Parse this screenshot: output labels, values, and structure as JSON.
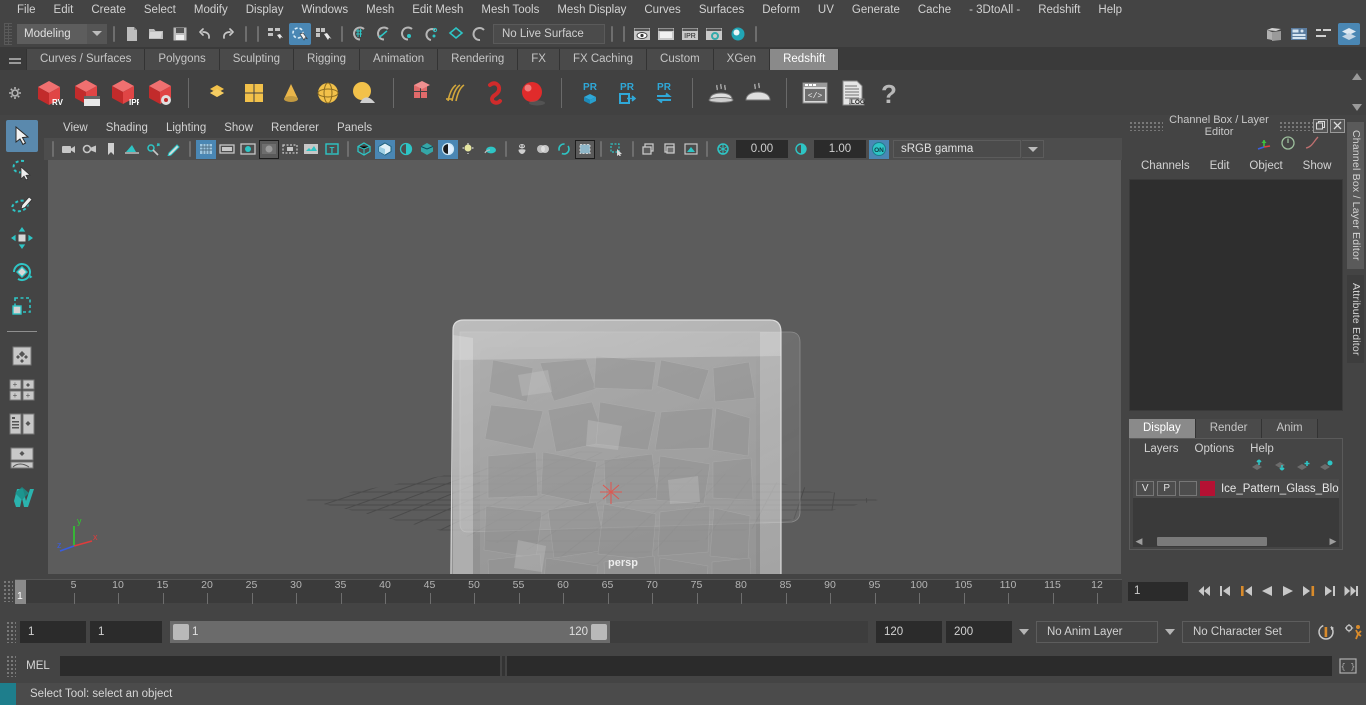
{
  "app": {
    "title": "Autodesk Maya"
  },
  "menubar": {
    "items": [
      {
        "label": "File"
      },
      {
        "label": "Edit"
      },
      {
        "label": "Create"
      },
      {
        "label": "Select"
      },
      {
        "label": "Modify"
      },
      {
        "label": "Display"
      },
      {
        "label": "Windows"
      },
      {
        "label": "Mesh"
      },
      {
        "label": "Edit Mesh"
      },
      {
        "label": "Mesh Tools"
      },
      {
        "label": "Mesh Display"
      },
      {
        "label": "Curves"
      },
      {
        "label": "Surfaces"
      },
      {
        "label": "Deform"
      },
      {
        "label": "UV"
      },
      {
        "label": "Generate"
      },
      {
        "label": "Cache"
      },
      {
        "label": "- 3DtoAll -"
      },
      {
        "label": "Redshift"
      },
      {
        "label": "Help"
      }
    ]
  },
  "statusline": {
    "mode": "Modeling",
    "live_surface": "No Live Surface",
    "icons": [
      "new-scene-icon",
      "open-scene-icon",
      "save-scene-icon",
      "undo-icon",
      "redo-icon",
      "select-by-hierarchy-icon",
      "select-by-object-icon",
      "select-by-component-icon",
      "snap-to-grid-icon",
      "snap-to-curve-icon",
      "snap-to-point-icon",
      "snap-to-projected-center-icon",
      "snap-to-view-plane-icon",
      "make-live-icon",
      "render-view-icon",
      "render-sequence-icon",
      "ipr-render-icon",
      "render-settings-icon",
      "hypershade-icon"
    ],
    "right_icons": [
      "show-hide-editor-icon",
      "attribute-editor-icon",
      "tool-settings-icon",
      "channel-box-icon"
    ]
  },
  "shelf": {
    "tabs": [
      {
        "label": "Curves / Surfaces",
        "active": false
      },
      {
        "label": "Polygons",
        "active": false
      },
      {
        "label": "Sculpting",
        "active": false
      },
      {
        "label": "Rigging",
        "active": false
      },
      {
        "label": "Animation",
        "active": false
      },
      {
        "label": "Rendering",
        "active": false
      },
      {
        "label": "FX",
        "active": false
      },
      {
        "label": "FX Caching",
        "active": false
      },
      {
        "label": "Custom",
        "active": false
      },
      {
        "label": "XGen",
        "active": false
      },
      {
        "label": "Redshift",
        "active": true
      }
    ],
    "buttons": [
      "redshift-rv-icon",
      "redshift-render-sequence-icon",
      "redshift-ipr-icon",
      "redshift-render-settings-icon",
      "polygon-plane-icon",
      "polygon-cube-icon",
      "polygon-cone-icon",
      "polygon-sphere-icon",
      "polygon-primitives-icon",
      "redshift-proxy-icon",
      "redshift-hair-icon",
      "redshift-volume-icon",
      "redshift-sphere-icon",
      "pr-bake-icon",
      "pr-export-icon",
      "pr-transfer-icon",
      "bake-set-icon",
      "bake-all-icon",
      "script-editor-icon",
      "log-file-icon",
      "help-icon"
    ]
  },
  "left_toolbar": {
    "tools": [
      {
        "name": "select-tool",
        "active": true
      },
      {
        "name": "lasso-select-tool",
        "active": false
      },
      {
        "name": "paint-select-tool",
        "active": false
      },
      {
        "name": "move-tool",
        "active": false
      },
      {
        "name": "rotate-tool",
        "active": false
      },
      {
        "name": "scale-tool",
        "active": false
      },
      {
        "name": "last-tool",
        "active": false
      },
      {
        "name": "single-pane-layout",
        "active": false
      },
      {
        "name": "four-pane-layout",
        "active": false
      },
      {
        "name": "outliner-persp-layout",
        "active": false
      },
      {
        "name": "persp-graph-layout",
        "active": false
      },
      {
        "name": "maya-logo",
        "active": false
      }
    ]
  },
  "viewport": {
    "menus": [
      {
        "label": "View"
      },
      {
        "label": "Shading"
      },
      {
        "label": "Lighting"
      },
      {
        "label": "Show"
      },
      {
        "label": "Renderer"
      },
      {
        "label": "Panels"
      }
    ],
    "camera_label": "persp",
    "exposure": "0.00",
    "gamma": "1.00",
    "color_management": "sRGB gamma",
    "toolbar_icons": [
      "select-camera-icon",
      "camera-attributes-icon",
      "bookmark-icon",
      "image-plane-icon",
      "two-d-pan-zoom-icon",
      "grease-pencil-icon",
      "grid-icon",
      "film-gate-icon",
      "resolution-gate-icon",
      "gate-mask-icon",
      "film-origin-icon",
      "safe-action-icon",
      "texture-placement-icon",
      "wireframe-icon",
      "smooth-shade-all-icon",
      "shaded-wireframe-icon",
      "textured-icon",
      "use-all-lights-icon",
      "shadows-icon",
      "ambient-occlusion-icon",
      "anti-alias-icon",
      "motion-blur-icon",
      "depth-of-field-icon",
      "isolate-select-icon",
      "xray-icon",
      "xray-joints-icon",
      "xray-active-components-icon",
      "exposure-icon",
      "gamma-icon",
      "color-management-icon"
    ],
    "axis_labels": {
      "x": "x",
      "y": "y",
      "z": "z"
    }
  },
  "right_panel": {
    "title": "Channel Box / Layer Editor",
    "window_buttons": [
      "restore-icon",
      "close-icon"
    ],
    "channel_menus": [
      {
        "label": "Channels"
      },
      {
        "label": "Edit"
      },
      {
        "label": "Object"
      },
      {
        "label": "Show"
      }
    ],
    "layer_tabs": [
      {
        "label": "Display",
        "active": true
      },
      {
        "label": "Render",
        "active": false
      },
      {
        "label": "Anim",
        "active": false
      }
    ],
    "layer_menus": [
      {
        "label": "Layers"
      },
      {
        "label": "Options"
      },
      {
        "label": "Help"
      }
    ],
    "layers": [
      {
        "visibility": "V",
        "playback": "P",
        "third": "",
        "color": "#b51133",
        "name": "Ice_Pattern_Glass_Block"
      }
    ],
    "vertical_tabs": [
      {
        "label": "Channel Box / Layer Editor"
      },
      {
        "label": "Attribute Editor"
      }
    ]
  },
  "timeline": {
    "ticks": [
      {
        "value": "5"
      },
      {
        "value": "10"
      },
      {
        "value": "15"
      },
      {
        "value": "20"
      },
      {
        "value": "25"
      },
      {
        "value": "30"
      },
      {
        "value": "35"
      },
      {
        "value": "40"
      },
      {
        "value": "45"
      },
      {
        "value": "50"
      },
      {
        "value": "55"
      },
      {
        "value": "60"
      },
      {
        "value": "65"
      },
      {
        "value": "70"
      },
      {
        "value": "75"
      },
      {
        "value": "80"
      },
      {
        "value": "85"
      },
      {
        "value": "90"
      },
      {
        "value": "95"
      },
      {
        "value": "100"
      },
      {
        "value": "105"
      },
      {
        "value": "110"
      },
      {
        "value": "115"
      },
      {
        "value": "12"
      }
    ],
    "current_frame": "1",
    "current_frame_field": "1",
    "playback_buttons": [
      "go-to-start-icon",
      "step-back-frame-icon",
      "step-back-key-icon",
      "play-backwards-icon",
      "play-forwards-icon",
      "step-forward-key-icon",
      "step-forward-frame-icon",
      "go-to-end-icon"
    ]
  },
  "range_slider": {
    "anim_start": "1",
    "range_start": "1",
    "range_bar_start": "1",
    "range_bar_end": "120",
    "range_end": "120",
    "anim_end": "200",
    "anim_layer": "No Anim Layer",
    "character_set": "No Character Set",
    "buttons": [
      "auto-key-icon",
      "animation-preferences-icon"
    ]
  },
  "command_line": {
    "label": "MEL",
    "value": "",
    "placeholder": "",
    "script-editor-button": "script-editor-icon"
  },
  "help_line": {
    "text": "Select Tool: select an object"
  },
  "colors": {
    "accent_blue": "#4a87b4",
    "accent_teal": "#21a5b5",
    "layer_red": "#b51133",
    "orange": "#d97b29",
    "panel_bg": "#444444",
    "viewport_bg": "#5c5c5c"
  }
}
